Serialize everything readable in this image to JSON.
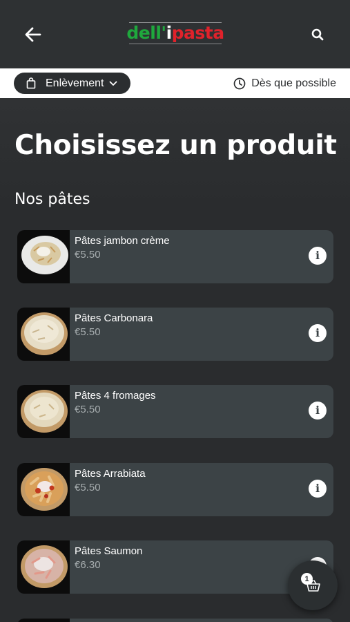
{
  "header": {
    "logo": {
      "part1": "dell'",
      "part2": "i",
      "part3": "pasta"
    },
    "back_icon": "arrow-left-icon",
    "search_icon": "search-icon"
  },
  "order_bar": {
    "mode_label": "Enlèvement",
    "mode_icon": "shopping-bag-icon",
    "time_label": "Dès que possible",
    "time_icon": "clock-icon"
  },
  "page": {
    "title": "Choisissez un produit",
    "section_title": "Nos pâtes"
  },
  "products": [
    {
      "name": "Pâtes jambon crème",
      "price": "€5.50"
    },
    {
      "name": "Pâtes Carbonara",
      "price": "€5.50"
    },
    {
      "name": "Pâtes 4 fromages",
      "price": "€5.50"
    },
    {
      "name": "Pâtes Arrabiata",
      "price": "€5.50"
    },
    {
      "name": "Pâtes Saumon",
      "price": "€6.30"
    }
  ],
  "info_label": "i",
  "cart": {
    "count": "1",
    "icon": "basket-icon"
  },
  "colors": {
    "header_bg": "#2e3133",
    "card_bg": "#3c4346",
    "logo_green": "#1fa83d",
    "logo_red": "#e0222b"
  }
}
